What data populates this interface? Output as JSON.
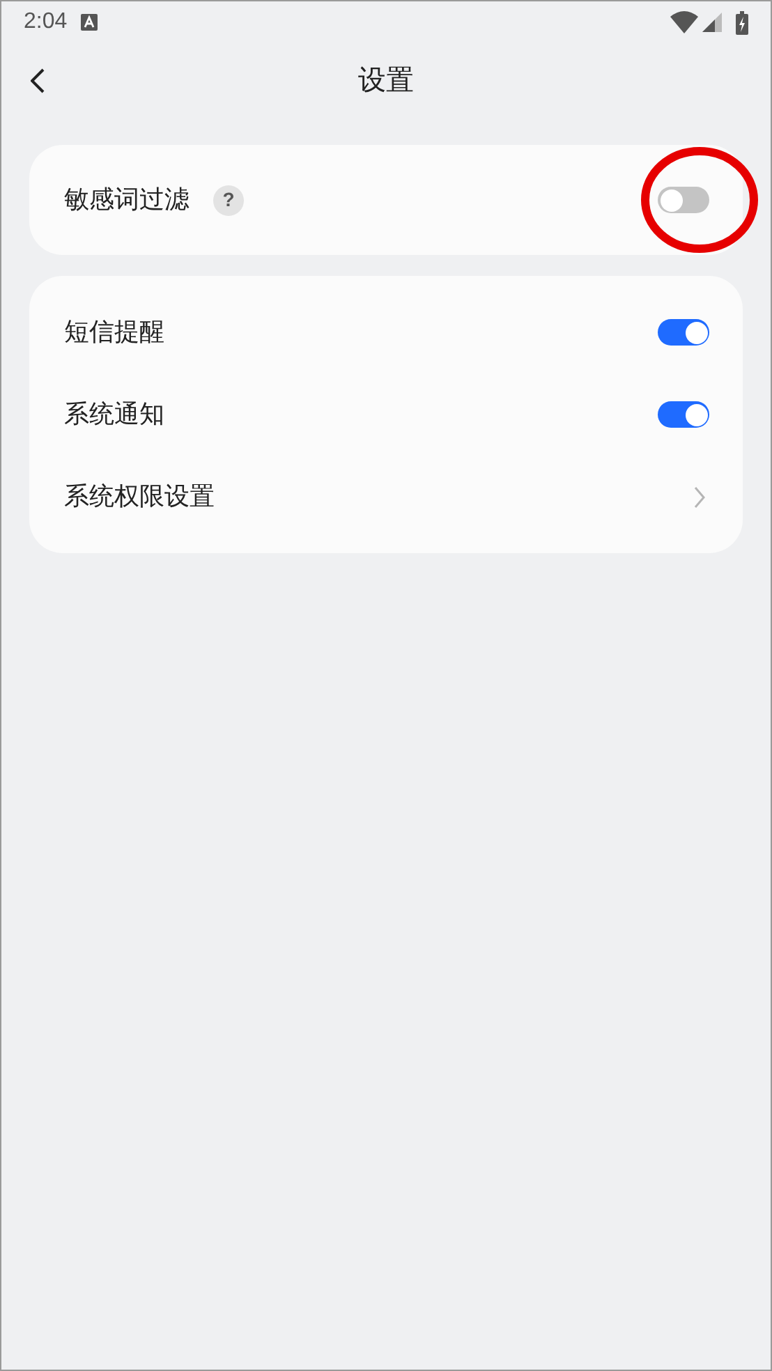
{
  "status_bar": {
    "time": "2:04"
  },
  "header": {
    "title": "设置"
  },
  "groups": [
    {
      "items": [
        {
          "kind": "toggle",
          "label": "敏感词过滤",
          "help": "?",
          "on": false,
          "circled": true
        }
      ]
    },
    {
      "items": [
        {
          "kind": "toggle",
          "label": "短信提醒",
          "on": true,
          "circled": false
        },
        {
          "kind": "toggle",
          "label": "系统通知",
          "on": true,
          "circled": false
        },
        {
          "kind": "link",
          "label": "系统权限设置",
          "circled": false
        }
      ]
    }
  ]
}
